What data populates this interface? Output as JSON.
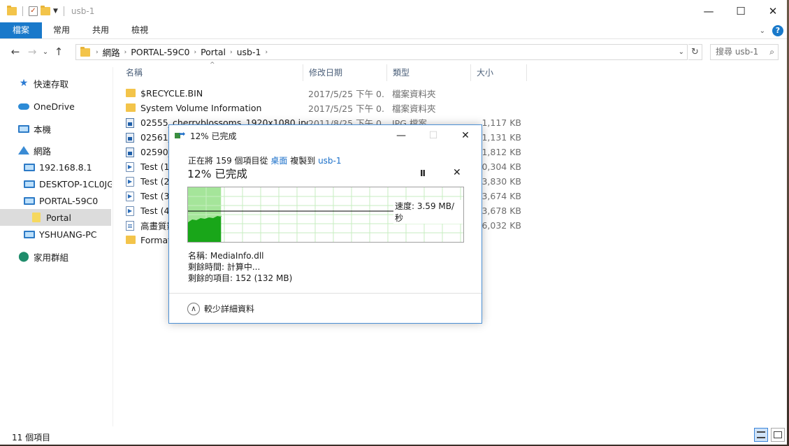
{
  "window": {
    "title": "usb-1",
    "minimize": "—",
    "maximize": "☐",
    "close": "✕"
  },
  "ribbon": {
    "tabs": [
      "檔案",
      "常用",
      "共用",
      "檢視"
    ],
    "help": "?",
    "expand": "⌄"
  },
  "address": {
    "crumbs": [
      "網路",
      "PORTAL-59C0",
      "Portal",
      "usb-1"
    ],
    "search_placeholder": "搜尋 usb-1"
  },
  "sidebar": {
    "items": [
      {
        "label": "快速存取",
        "icon": "star-icon"
      },
      {
        "label": "OneDrive",
        "icon": "cloud-icon"
      },
      {
        "label": "本機",
        "icon": "pc-icon"
      },
      {
        "label": "網路",
        "icon": "network-icon"
      },
      {
        "label": "192.168.8.1",
        "icon": "computer-icon"
      },
      {
        "label": "DESKTOP-1CL0JGI",
        "icon": "computer-icon"
      },
      {
        "label": "PORTAL-59C0",
        "icon": "computer-icon"
      },
      {
        "label": "Portal",
        "icon": "share-folder-icon",
        "selected": true
      },
      {
        "label": "YSHUANG-PC",
        "icon": "computer-icon"
      },
      {
        "label": "家用群組",
        "icon": "homegroup-icon"
      }
    ]
  },
  "columns": [
    "名稱",
    "修改日期",
    "類型",
    "大小"
  ],
  "files": [
    {
      "name": "$RECYCLE.BIN",
      "date": "2017/5/25 下午 0...",
      "type": "檔案資料夾",
      "size": "",
      "icon": "folder"
    },
    {
      "name": "System Volume Information",
      "date": "2017/5/25 下午 0...",
      "type": "檔案資料夾",
      "size": "",
      "icon": "folder"
    },
    {
      "name": "02555_cherryblossoms_1920x1080.jpg",
      "date": "2011/8/25 下午 0...",
      "type": "JPG 檔案",
      "size": "1,117 KB",
      "icon": "image"
    },
    {
      "name": "02561_",
      "date": "",
      "type": "",
      "size": "1,131 KB",
      "icon": "image"
    },
    {
      "name": "02590_",
      "date": "",
      "type": "",
      "size": "1,812 KB",
      "icon": "image"
    },
    {
      "name": "Test (1)",
      "date": "",
      "type": "",
      "size": "10,304 KB",
      "icon": "video"
    },
    {
      "name": "Test (2)",
      "date": "",
      "type": "",
      "size": "3,830 KB",
      "icon": "video"
    },
    {
      "name": "Test (3)",
      "date": "",
      "type": "",
      "size": "3,674 KB",
      "icon": "video"
    },
    {
      "name": "Test (4)",
      "date": "",
      "type": "",
      "size": "3,678 KB",
      "icon": "video"
    },
    {
      "name": "高畫質影",
      "date": "",
      "type": "",
      "size": "06,032 KB",
      "icon": "doc"
    },
    {
      "name": "Format",
      "date": "",
      "type": "",
      "size": "",
      "icon": "folder"
    }
  ],
  "status": {
    "count": "11 個項目"
  },
  "dialog": {
    "title": "12% 已完成",
    "line_prefix": "正在將 159 個項目從",
    "source": "桌面",
    "line_mid": "複製到",
    "dest": "usb-1",
    "progress_text": "12% 已完成",
    "progress": 0.12,
    "speed": "速度: 3.59 MB/秒",
    "pause": "II",
    "cancel": "✕",
    "name_line": "名稱: MediaInfo.dll",
    "time_line": "剩餘時間: 計算中...",
    "items_line": "剩餘的項目: 152 (132 MB)",
    "less_details": "較少詳細資料",
    "colors": {
      "fill": "#19a619",
      "bg": "#a5e59a",
      "grid": "#c7eec0"
    }
  }
}
